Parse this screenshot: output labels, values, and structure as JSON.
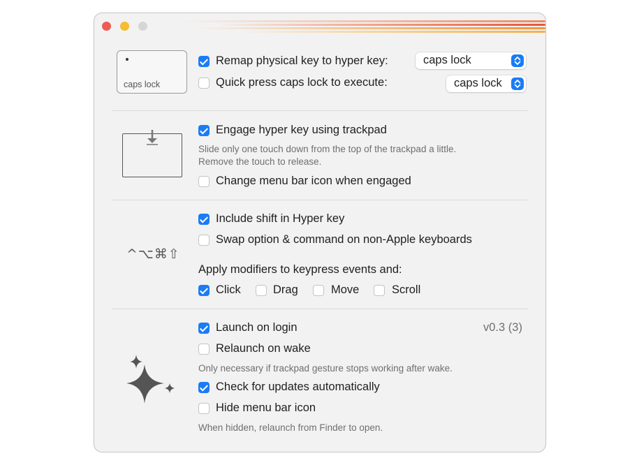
{
  "window": {
    "traffic_lights": [
      {
        "name": "close",
        "color": "#ee5b52"
      },
      {
        "name": "minimize",
        "color": "#f5bd2f"
      },
      {
        "name": "zoom",
        "color": "#d6d6d6"
      }
    ],
    "accent_color": "#1a7cf5"
  },
  "section_keyboard": {
    "key_label": "caps lock",
    "remap": {
      "label": "Remap physical key to hyper key:",
      "checked": true,
      "select_value": "caps lock"
    },
    "quick_press": {
      "label": "Quick press caps lock to execute:",
      "checked": false,
      "select_value": "caps lock"
    }
  },
  "section_trackpad": {
    "engage": {
      "label": "Engage hyper key using trackpad",
      "checked": true
    },
    "hint_line1": "Slide only one touch down from the top of the trackpad a little.",
    "hint_line2": "Remove the touch to release.",
    "menu_icon": {
      "label": "Change menu bar icon when engaged",
      "checked": false
    }
  },
  "section_modifiers": {
    "symbols": "^⌥⌘⇧",
    "include_shift": {
      "label": "Include shift in Hyper key",
      "checked": true
    },
    "swap": {
      "label": "Swap option & command on non-Apple keyboards",
      "checked": false
    },
    "apply_label": "Apply modifiers to keypress events and:",
    "events": {
      "click": {
        "label": "Click",
        "checked": true
      },
      "drag": {
        "label": "Drag",
        "checked": false
      },
      "move": {
        "label": "Move",
        "checked": false
      },
      "scroll": {
        "label": "Scroll",
        "checked": false
      }
    }
  },
  "section_general": {
    "version": "v0.3 (3)",
    "launch_login": {
      "label": "Launch on login",
      "checked": true
    },
    "relaunch_wake": {
      "label": "Relaunch on wake",
      "checked": false
    },
    "relaunch_hint": "Only necessary if trackpad gesture stops working after wake.",
    "check_updates": {
      "label": "Check for updates automatically",
      "checked": true
    },
    "hide_icon": {
      "label": "Hide menu bar icon",
      "checked": false
    },
    "hide_hint": "When hidden, relaunch from Finder to open."
  }
}
